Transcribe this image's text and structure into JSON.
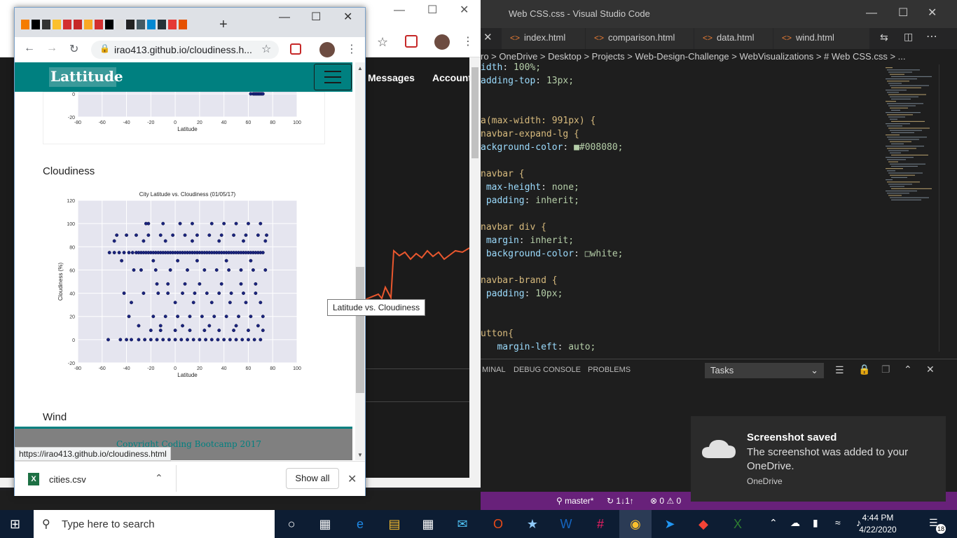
{
  "background_browser": {
    "nav_links": [
      "Messages",
      "Account"
    ]
  },
  "vscode": {
    "title": "Web CSS.css - Visual Studio Code",
    "tabs": [
      "index.html",
      "comparison.html",
      "data.html",
      "wind.html"
    ],
    "breadcrumb": [
      "ro",
      "OneDrive",
      "Desktop",
      "Projects",
      "Web-Design-Challenge",
      "WebVisualizations",
      "# Web CSS.css",
      "..."
    ],
    "panel_tabs": [
      "MINAL",
      "DEBUG CONSOLE",
      "PROBLEMS"
    ],
    "tasks_label": "Tasks",
    "status_branch": "master*",
    "status_sync": "↻ 1↓1↑",
    "status_problems": "⊗ 0 ⚠ 0",
    "code_lines": [
      "idth: 100%;",
      "adding-top: 13px;",
      "",
      "",
      "a(max-width: 991px) {",
      "navbar-expand-lg {",
      "ackground-color: ■#008080;",
      "",
      "navbar {",
      " max-height: none;",
      " padding: inherit;",
      "",
      "navbar div {",
      " margin: inherit;",
      " background-color: □white;",
      "",
      "navbar-brand {",
      " padding: 10px;",
      "",
      "",
      "utton{",
      "   margin-left: auto;"
    ],
    "accent_color": "#68217a"
  },
  "toast": {
    "title": "Screenshot saved",
    "body": "The screenshot was added to your OneDrive.",
    "source": "OneDrive"
  },
  "popup": {
    "url": "irao413.github.io/cloudiness.h...",
    "brand": "Lattitude",
    "sections": [
      "Cloudiness",
      "Wind"
    ],
    "tooltip": "Latitude vs. Cloudiness",
    "footer": "Copyright Coding Bootcamp 2017",
    "status_url": "https://irao413.github.io/cloudiness.html",
    "download_file": "cities.csv",
    "show_all": "Show all",
    "nav_color": "#008080"
  },
  "taskbar": {
    "search_placeholder": "Type here to search",
    "time": "4:44 PM",
    "date": "4/22/2020",
    "notification_count": "18"
  },
  "chart_data": [
    {
      "type": "scatter",
      "title": "",
      "xlabel": "Latitude",
      "ylabel": "",
      "xlim": [
        -80,
        100
      ],
      "ylim": [
        -20,
        20
      ],
      "xticks": [
        "-80",
        "-60",
        "-40",
        "-20",
        "0",
        "20",
        "40",
        "60",
        "80",
        "100"
      ],
      "yticks": [
        "-20",
        "0"
      ],
      "x": [
        62,
        64,
        65,
        66,
        67,
        68,
        69,
        70,
        71,
        72
      ],
      "y": [
        0,
        0,
        0,
        0,
        0,
        0,
        0,
        0,
        0,
        0
      ]
    },
    {
      "type": "scatter",
      "title": "City Latitude vs. Cloudiness (01/05/17)",
      "xlabel": "Latitude",
      "ylabel": "Cloudiness (%)",
      "xlim": [
        -80,
        100
      ],
      "ylim": [
        -20,
        120
      ],
      "xticks": [
        "-80",
        "-60",
        "-40",
        "-20",
        "0",
        "20",
        "40",
        "60",
        "80",
        "100"
      ],
      "yticks": [
        "-20",
        "0",
        "20",
        "40",
        "60",
        "80",
        "100",
        "120"
      ],
      "grid": true,
      "x": [
        -54,
        -50,
        -46,
        -42,
        -38,
        -35,
        -32,
        -28,
        -26,
        -24,
        -22,
        -20,
        -18,
        -16,
        -14,
        -12,
        -10,
        -8,
        -6,
        -4,
        -2,
        0,
        2,
        4,
        6,
        8,
        10,
        12,
        14,
        16,
        18,
        20,
        22,
        24,
        26,
        28,
        30,
        32,
        34,
        36,
        38,
        40,
        42,
        44,
        46,
        48,
        50,
        52,
        54,
        56,
        58,
        60,
        62,
        64,
        66,
        68,
        70,
        72,
        -45,
        -40,
        -36,
        -30,
        -25,
        -20,
        -15,
        -10,
        -5,
        0,
        5,
        10,
        15,
        20,
        25,
        30,
        35,
        40,
        45,
        50,
        55,
        60,
        65,
        70,
        -55,
        -48,
        -40,
        -32,
        -22,
        -12,
        -2,
        8,
        18,
        28,
        38,
        48,
        58,
        68,
        75,
        -30,
        -18,
        -8,
        2,
        12,
        22,
        32,
        42,
        52,
        62,
        72,
        -38,
        -26,
        -14,
        -6,
        6,
        16,
        26,
        36,
        46,
        56,
        66,
        -42,
        -28,
        -16,
        -4,
        10,
        24,
        34,
        44,
        54,
        64,
        74,
        -34,
        -22,
        -10,
        4,
        14,
        30,
        40,
        50,
        60,
        70,
        -24,
        -12,
        0,
        12,
        24,
        36,
        48,
        60,
        72,
        -20,
        -6,
        8,
        20,
        38,
        54,
        66,
        -15,
        0,
        15,
        30,
        45,
        58,
        70,
        -36,
        -18,
        2,
        18,
        42,
        62,
        -44,
        -26,
        -8,
        14,
        36,
        56,
        74,
        -50,
        -30,
        -12,
        6,
        28,
        50,
        68
      ],
      "y": [
        75,
        75,
        75,
        75,
        75,
        75,
        75,
        75,
        75,
        75,
        75,
        75,
        75,
        75,
        75,
        75,
        75,
        75,
        75,
        75,
        75,
        75,
        75,
        75,
        75,
        75,
        75,
        75,
        75,
        75,
        75,
        75,
        75,
        75,
        75,
        75,
        75,
        75,
        75,
        75,
        75,
        75,
        75,
        75,
        75,
        75,
        75,
        75,
        75,
        75,
        75,
        75,
        75,
        75,
        75,
        75,
        75,
        75,
        0,
        0,
        0,
        0,
        0,
        0,
        0,
        0,
        0,
        0,
        0,
        0,
        0,
        0,
        0,
        0,
        0,
        0,
        0,
        0,
        0,
        0,
        0,
        0,
        0,
        90,
        90,
        90,
        90,
        90,
        90,
        90,
        90,
        90,
        90,
        90,
        90,
        90,
        90,
        75,
        20,
        20,
        20,
        20,
        20,
        20,
        20,
        20,
        20,
        20,
        20,
        40,
        40,
        40,
        40,
        40,
        40,
        40,
        40,
        40,
        40,
        40,
        60,
        60,
        60,
        60,
        60,
        60,
        60,
        60,
        60,
        60,
        60,
        100,
        100,
        100,
        100,
        100,
        100,
        100,
        100,
        100,
        100,
        8,
        8,
        8,
        8,
        8,
        8,
        8,
        8,
        8,
        48,
        48,
        48,
        48,
        48,
        48,
        48,
        32,
        32,
        32,
        32,
        32,
        32,
        32,
        68,
        68,
        68,
        68,
        68,
        68,
        85,
        85,
        85,
        85,
        85,
        85,
        85,
        12,
        12,
        12,
        12,
        12,
        12,
        12
      ]
    }
  ]
}
